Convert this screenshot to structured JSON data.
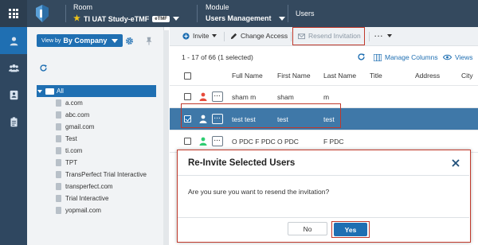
{
  "header": {
    "room_label": "Room",
    "room_name": "TI UAT Study-eTMF",
    "room_badge": "eTMF",
    "module_label": "Module",
    "module_name": "Users Management",
    "page_title": "Users"
  },
  "left_panel": {
    "view_by_prefix": "View by",
    "view_by_value": "By Company",
    "tree_root": "All",
    "tree_items": [
      "a.com",
      "abc.com",
      "gmail.com",
      "Test",
      "ti.com",
      "TPT",
      "TransPerfect Trial Interactive",
      "transperfect.com",
      "Trial Interactive",
      "yopmail.com"
    ]
  },
  "toolbar": {
    "invite": "Invite",
    "change_access": "Change Access",
    "resend_invitation": "Resend Invitation",
    "more": "···"
  },
  "listing": {
    "count": "1 - 17 of 66 (1 selected)",
    "manage_columns": "Manage Columns",
    "views": "Views"
  },
  "table": {
    "columns": [
      "Full Name",
      "First Name",
      "Last Name",
      "Title",
      "Address",
      "City"
    ],
    "rows": [
      {
        "full_name": "sham m",
        "first_name": "sham",
        "last_name": "m",
        "selected": false,
        "user_color": "#e74c3c"
      },
      {
        "full_name": "test test",
        "first_name": "test",
        "last_name": "test",
        "selected": true,
        "user_color": "#ffffff"
      },
      {
        "full_name": "O PDC F PDC",
        "first_name": "O PDC",
        "last_name": "F PDC",
        "selected": false,
        "user_color": "#2ecc71"
      }
    ]
  },
  "dialog": {
    "title": "Re-Invite Selected Users",
    "message": "Are you sure you want to resend the invitation?",
    "no_label": "No",
    "yes_label": "Yes"
  },
  "colors": {
    "primary": "#1f6fb2",
    "topbar": "#34495e",
    "highlight": "#c0392b"
  }
}
